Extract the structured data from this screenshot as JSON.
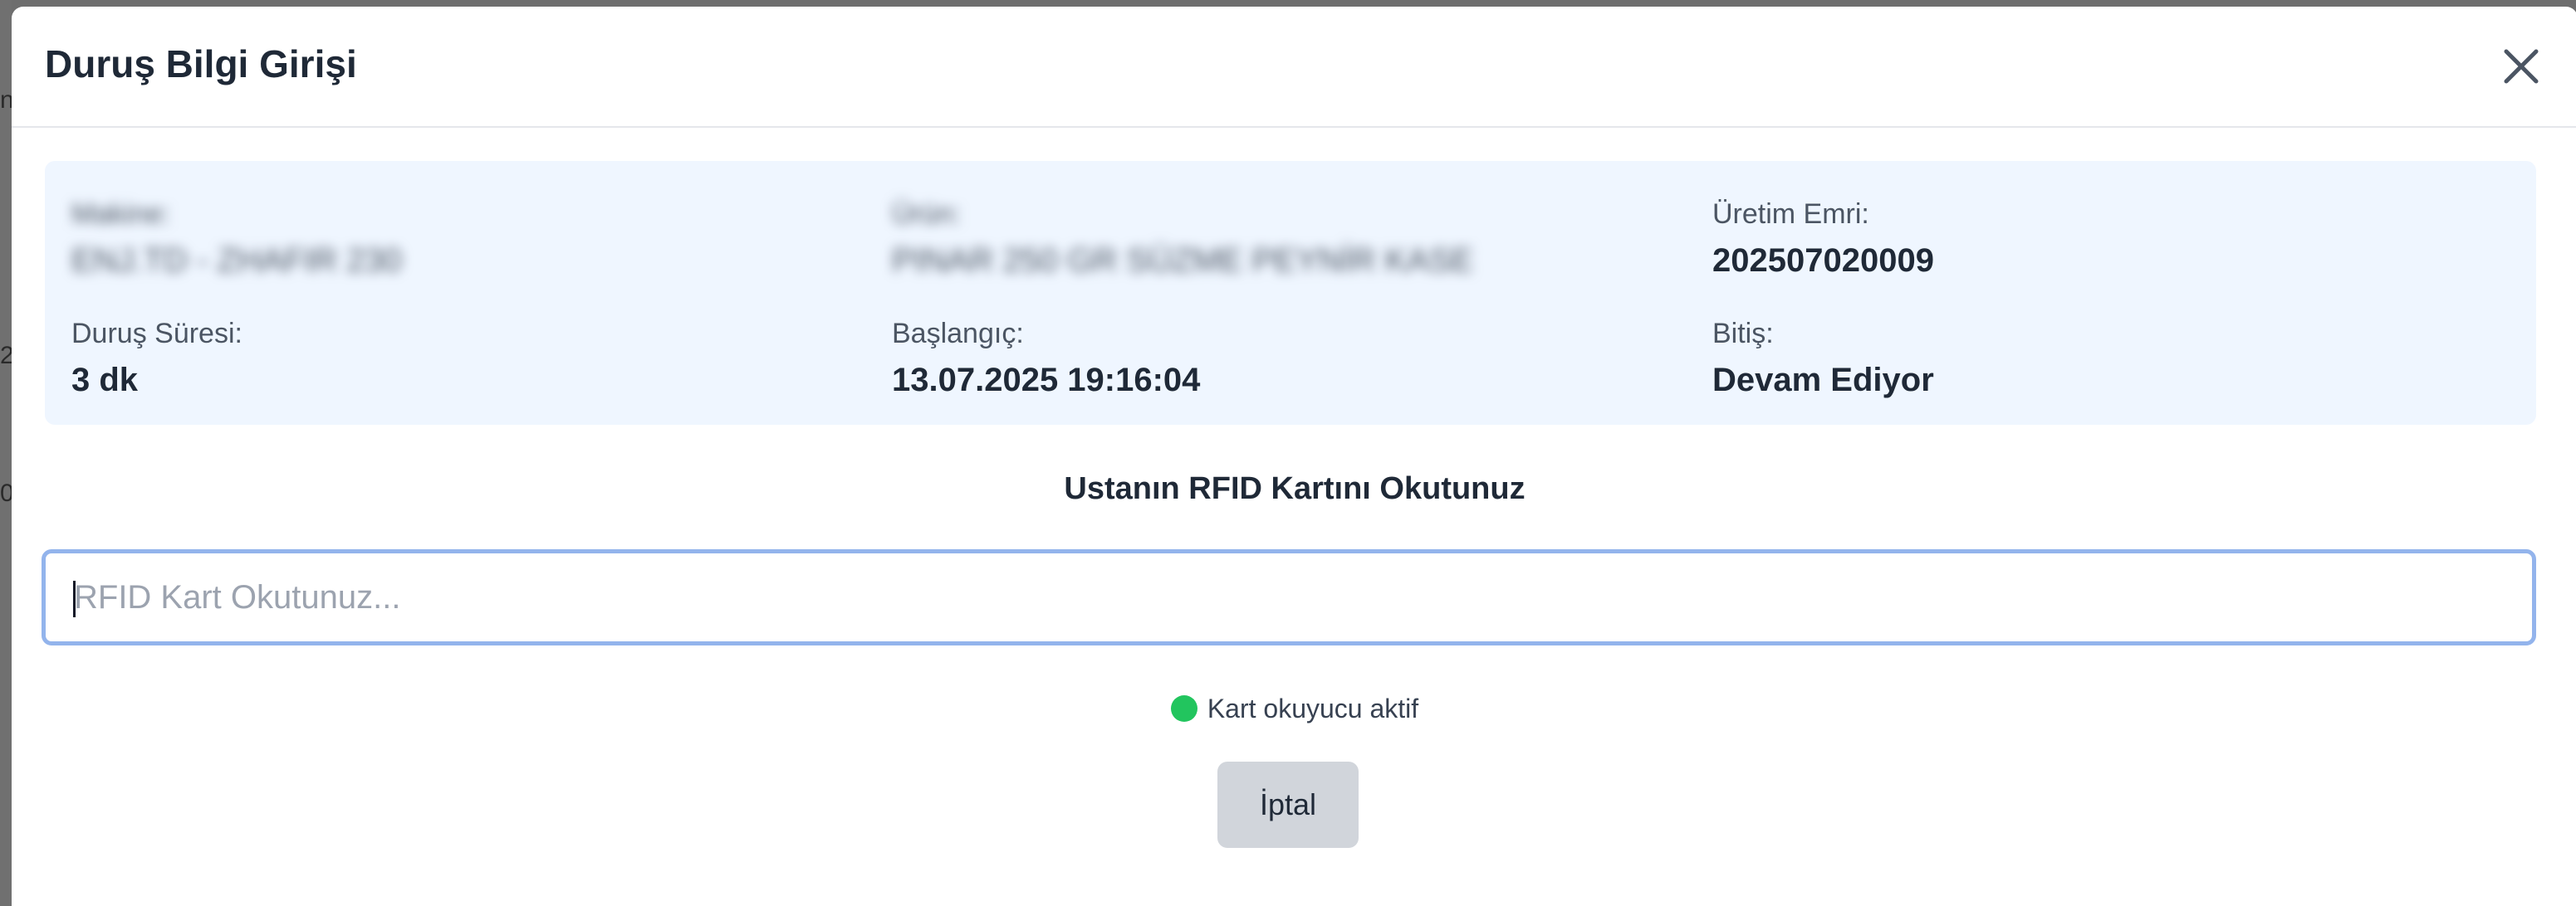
{
  "background": {
    "peek_texts": [
      "n",
      "2",
      "0"
    ]
  },
  "modal": {
    "title": "Duruş Bilgi Girişi",
    "close_icon": "close-icon"
  },
  "info": {
    "machine": {
      "label": "Makine:",
      "value": "ENJ.TD - ZHAFIR 230"
    },
    "product": {
      "label": "Ürün:",
      "value": "PINAR 250 GR SÜZME PEYNİR KASE"
    },
    "order": {
      "label": "Üretim Emri:",
      "value": "202507020009"
    },
    "duration": {
      "label": "Duruş Süresi:",
      "value": "3 dk"
    },
    "start": {
      "label": "Başlangıç:",
      "value": "13.07.2025 19:16:04"
    },
    "end": {
      "label": "Bitiş:",
      "value": "Devam Ediyor"
    }
  },
  "rfid": {
    "heading": "Ustanın RFID Kartını Okutunuz",
    "input_value": "",
    "placeholder": "RFID Kart Okutunuz...",
    "status_text": "Kart okuyucu aktif",
    "status_color": "#22c55e"
  },
  "actions": {
    "cancel_label": "İptal"
  },
  "colors": {
    "panel_bg": "#eff6ff",
    "input_focus_border": "#93b4ec",
    "cancel_bg": "#d1d5db"
  }
}
